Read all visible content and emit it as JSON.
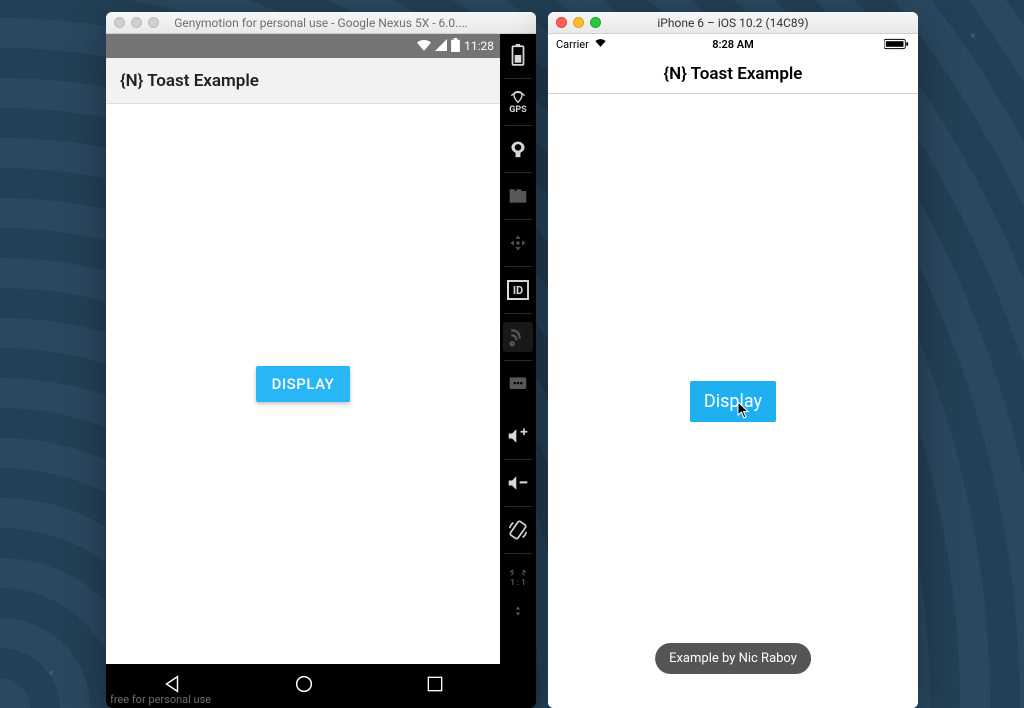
{
  "genymotion": {
    "window_title": "Genymotion for personal use - Google Nexus 5X - 6.0....",
    "status_time": "11:28",
    "app_title": "{N} Toast Example",
    "display_button": "DISPLAY",
    "watermark": "free for personal use",
    "toolbar": {
      "gps_label": "GPS",
      "id_label": "ID",
      "scale_label": "1 : 1"
    }
  },
  "ios": {
    "window_title": "iPhone 6 – iOS 10.2 (14C89)",
    "carrier": "Carrier",
    "status_time": "8:28 AM",
    "app_title": "{N} Toast Example",
    "display_button": "Display",
    "toast_text": "Example by Nic Raboy"
  }
}
